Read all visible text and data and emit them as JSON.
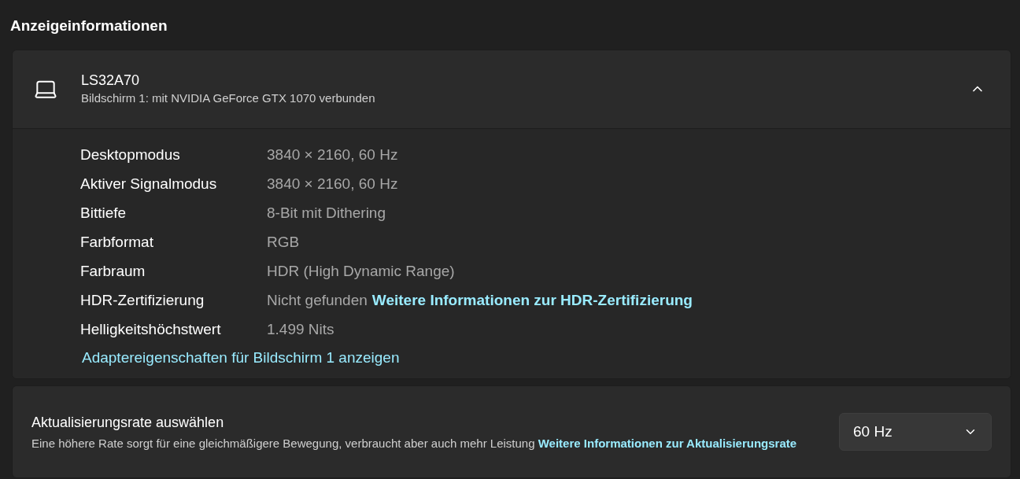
{
  "section_title": "Anzeigeinformationen",
  "display": {
    "name": "LS32A70",
    "subtitle": "Bildschirm 1: mit NVIDIA GeForce GTX 1070 verbunden",
    "expanded": true,
    "properties": [
      {
        "label": "Desktopmodus",
        "value": "3840 × 2160, 60 Hz"
      },
      {
        "label": "Aktiver Signalmodus",
        "value": "3840 × 2160, 60 Hz"
      },
      {
        "label": "Bittiefe",
        "value": "8-Bit mit Dithering"
      },
      {
        "label": "Farbformat",
        "value": "RGB"
      },
      {
        "label": "Farbraum",
        "value": "HDR (High Dynamic Range)"
      },
      {
        "label": "HDR-Zertifizierung",
        "value": "Nicht gefunden",
        "link": "Weitere Informationen zur HDR-Zertifizierung"
      },
      {
        "label": "Helligkeitshöchstwert",
        "value": "1.499 Nits"
      }
    ],
    "adapter_link": "Adaptereigenschaften für Bildschirm 1 anzeigen"
  },
  "refresh_rate": {
    "title": "Aktualisierungsrate auswählen",
    "description": "Eine höhere Rate sorgt für eine gleichmäßigere Bewegung, verbraucht aber auch mehr Leistung",
    "link": "Weitere Informationen zur Aktualisierungsrate",
    "value": "60 Hz"
  }
}
